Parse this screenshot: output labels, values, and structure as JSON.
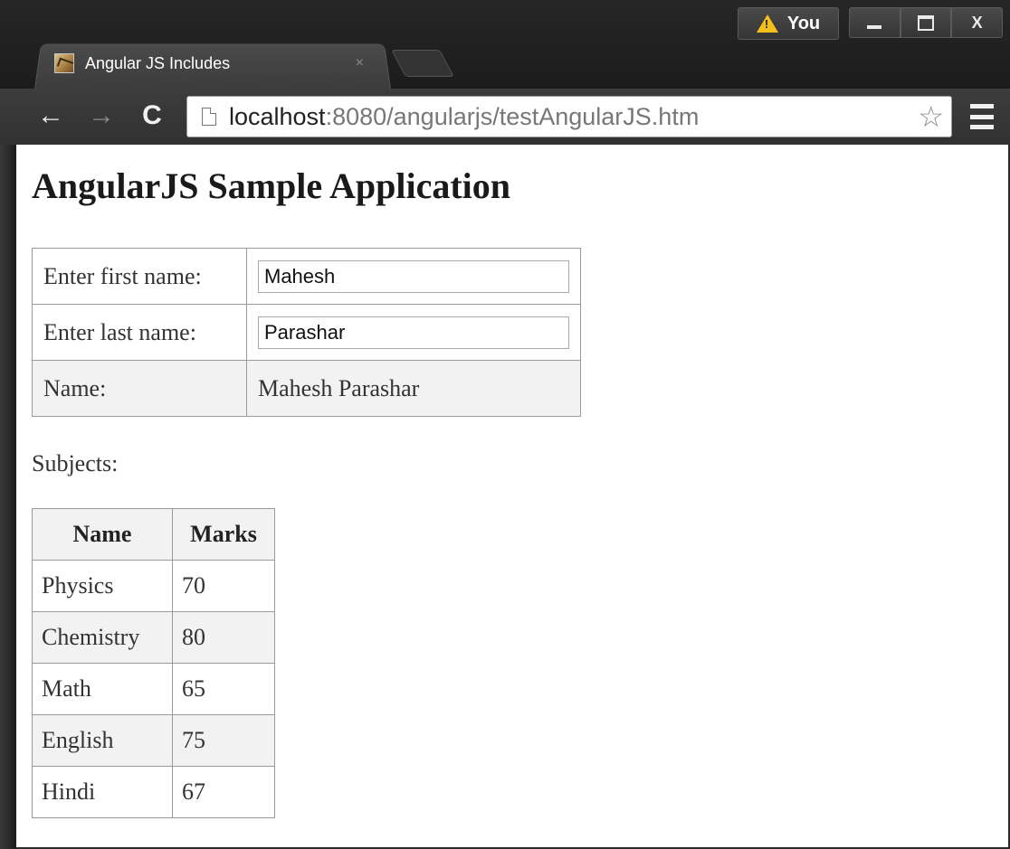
{
  "browser": {
    "tab_title": "Angular JS Includes",
    "tab_close": "×",
    "profile_label": "You",
    "window_close": "X",
    "url_host": "localhost",
    "url_rest": ":8080/angularjs/testAngularJS.htm",
    "back": "←",
    "forward": "→",
    "reload": "C",
    "star": "☆"
  },
  "page": {
    "title": "AngularJS Sample Application",
    "form": {
      "first_name_label": "Enter first name:",
      "first_name_value": "Mahesh",
      "last_name_label": "Enter last name:",
      "last_name_value": "Parashar",
      "name_label": "Name:",
      "name_value": "Mahesh Parashar"
    },
    "subjects_label": "Subjects:",
    "subjects_table": {
      "headers": [
        "Name",
        "Marks"
      ],
      "rows": [
        {
          "name": "Physics",
          "marks": "70"
        },
        {
          "name": "Chemistry",
          "marks": "80"
        },
        {
          "name": "Math",
          "marks": "65"
        },
        {
          "name": "English",
          "marks": "75"
        },
        {
          "name": "Hindi",
          "marks": "67"
        }
      ]
    }
  },
  "colors": {
    "warning": "#f4c01e",
    "row_shade": "#f2f2f2",
    "table_border": "#9a9a9a"
  }
}
